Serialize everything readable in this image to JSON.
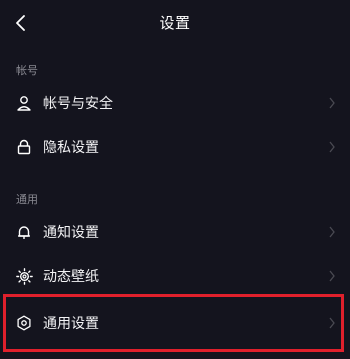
{
  "header": {
    "title": "设置",
    "back_icon": "chevron-left-icon"
  },
  "sections": [
    {
      "label": "帐号",
      "items": [
        {
          "label": "帐号与安全",
          "icon": "user-icon"
        },
        {
          "label": "隐私设置",
          "icon": "lock-icon"
        }
      ]
    },
    {
      "label": "通用",
      "items": [
        {
          "label": "通知设置",
          "icon": "bell-icon"
        },
        {
          "label": "动态壁纸",
          "icon": "sun-icon"
        },
        {
          "label": "通用设置",
          "icon": "gear-icon"
        }
      ]
    }
  ],
  "colors": {
    "background": "#14141e",
    "highlight": "#e0202c",
    "section_label": "#8a8a92"
  }
}
